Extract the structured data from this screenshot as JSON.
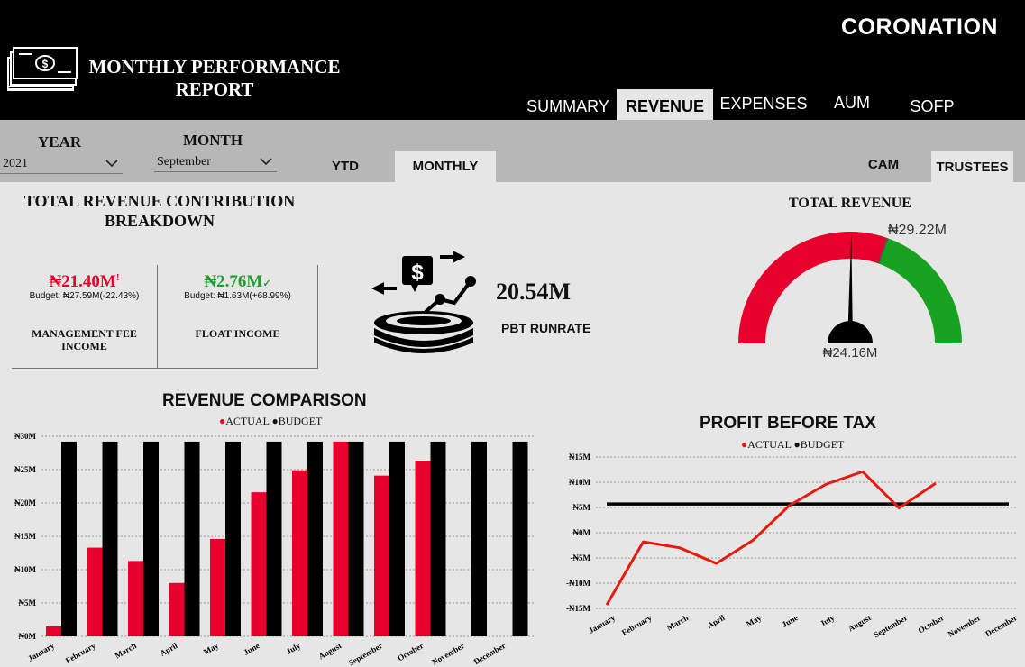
{
  "header": {
    "brand": "CORONATION",
    "report_title": "MONTHLY PERFORMANCE\nREPORT",
    "nav_tabs": [
      {
        "label": "SUMMARY"
      },
      {
        "label": "REVENUE"
      },
      {
        "label": "EXPENSES"
      },
      {
        "label": "AUM"
      },
      {
        "label": "SOFP"
      }
    ],
    "active_tab": "REVENUE"
  },
  "filters": {
    "year_label": "YEAR",
    "year_value": "2021",
    "month_label": "MONTH",
    "month_value": "September",
    "period_tabs": [
      {
        "label": "YTD"
      },
      {
        "label": "MONTHLY"
      }
    ],
    "active_period": "MONTHLY",
    "entity_tabs": [
      {
        "label": "CAM"
      },
      {
        "label": "TRUSTEES"
      }
    ],
    "active_entity": "TRUSTEES"
  },
  "kpis": {
    "section_title": "TOTAL REVENUE CONTRIBUTION\nBREAKDOWN",
    "management_fee": {
      "value": "₦21.40M",
      "indicator": "!",
      "budget": "Budget: ₦27.59M(-22.43%)",
      "label": "MANAGEMENT FEE\nINCOME",
      "color": "#e8002d"
    },
    "float_income": {
      "value": "₦2.76M",
      "indicator": "✓",
      "budget": "Budget: ₦1.63M(+68.99%)",
      "label": "FLOAT INCOME",
      "color": "#1aa32a"
    },
    "pbt_runrate": {
      "value": "20.54M",
      "label": "PBT RUNRATE",
      "icon": "money-growth-icon"
    }
  },
  "gauge": {
    "title": "TOTAL REVENUE",
    "target_label": "₦29.22M",
    "value_label": "₦24.16M",
    "min": 0,
    "max": 48,
    "value": 24.16,
    "target": 29.22,
    "colors": {
      "below": "#e8002d",
      "above": "#17a321",
      "hub": "#000000"
    }
  },
  "revenue_comparison": {
    "title": "REVENUE COMPARISON",
    "legend": [
      {
        "label": "ACTUAL",
        "color": "#e8002d"
      },
      {
        "label": "BUDGET",
        "color": "#000000"
      }
    ]
  },
  "profit_before_tax": {
    "title": "PROFIT BEFORE TAX",
    "legend": [
      {
        "label": "ACTUAL",
        "color": "#e8190f"
      },
      {
        "label": "BUDGET",
        "color": "#000000"
      }
    ]
  },
  "chart_data": [
    {
      "type": "bar",
      "title": "REVENUE COMPARISON",
      "categories": [
        "January",
        "February",
        "March",
        "April",
        "May",
        "June",
        "July",
        "August",
        "September",
        "October",
        "November",
        "December"
      ],
      "series": [
        {
          "name": "ACTUAL",
          "color": "#e8002d",
          "values": [
            1.5,
            13.3,
            11.3,
            8.0,
            14.6,
            21.6,
            24.9,
            29.2,
            24.1,
            26.3,
            null,
            null
          ]
        },
        {
          "name": "BUDGET",
          "color": "#000000",
          "values": [
            29.2,
            29.2,
            29.2,
            29.2,
            29.2,
            29.2,
            29.2,
            29.2,
            29.2,
            29.2,
            29.2,
            29.2
          ]
        }
      ],
      "ylim": [
        0,
        30
      ],
      "yticks": [
        0,
        5,
        10,
        15,
        20,
        25,
        30
      ],
      "ytick_labels": [
        "₦0M",
        "₦5M",
        "₦10M",
        "₦15M",
        "₦20M",
        "₦25M",
        "₦30M"
      ],
      "grid": true
    },
    {
      "type": "line",
      "title": "PROFIT BEFORE TAX",
      "categories": [
        "January",
        "February",
        "March",
        "April",
        "May",
        "June",
        "July",
        "August",
        "September",
        "October",
        "November",
        "December"
      ],
      "series": [
        {
          "name": "ACTUAL",
          "color": "#e8190f",
          "values": [
            -14.3,
            -1.8,
            -3.0,
            -6.1,
            -1.5,
            5.4,
            9.6,
            12.1,
            4.9,
            9.8,
            null,
            null
          ]
        },
        {
          "name": "BUDGET",
          "color": "#000000",
          "values": [
            5.7,
            5.7,
            5.7,
            5.7,
            5.7,
            5.7,
            5.7,
            5.7,
            5.7,
            5.7,
            5.7,
            5.7
          ]
        }
      ],
      "ylim": [
        -15,
        15
      ],
      "yticks": [
        -15,
        -10,
        -5,
        0,
        5,
        10,
        15
      ],
      "ytick_labels": [
        "-₦15M",
        "-₦10M",
        "-₦5M",
        "₦0M",
        "₦5M",
        "₦10M",
        "₦15M"
      ],
      "grid": true
    }
  ]
}
